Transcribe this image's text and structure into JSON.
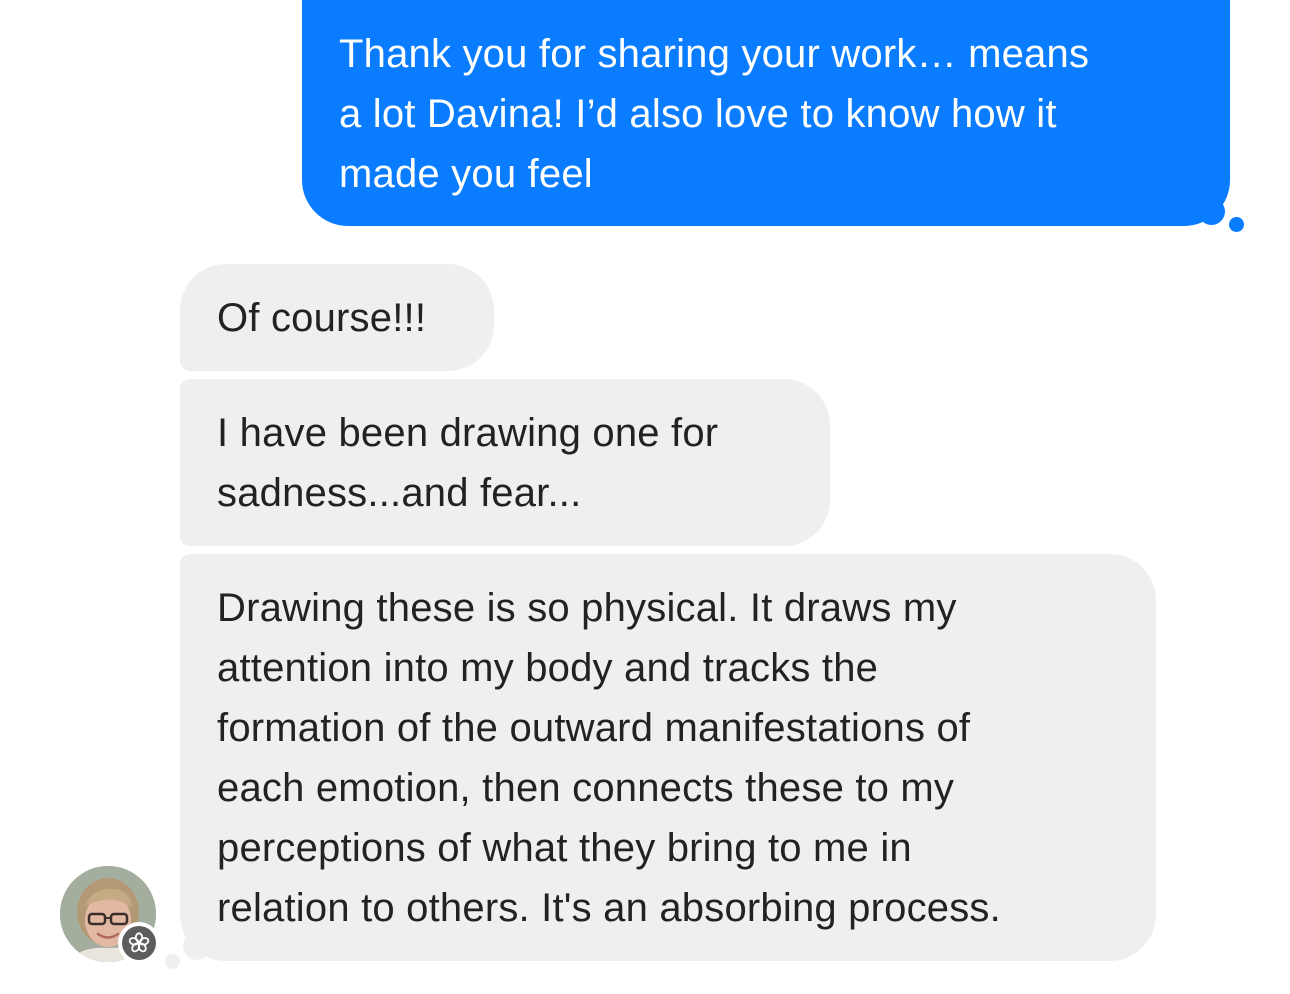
{
  "conversation": {
    "messages": [
      {
        "direction": "sent",
        "text": "Thank you for sharing your work… means\na lot Davina! I’d also love to know how it\nmade you feel"
      },
      {
        "direction": "received",
        "text": "Of course!!!"
      },
      {
        "direction": "received",
        "text": "I have been drawing one for\nsadness...and fear..."
      },
      {
        "direction": "received",
        "text": "Drawing these is so physical. It draws my\nattention into my body and tracks the\nformation of the outward manifestations of\neach emotion, then connects these to my\nperceptions of what they bring to me in\nrelation to others. It's an absorbing process."
      }
    ],
    "contact_avatar": {
      "icon": "contact-avatar",
      "badge_icon": "flower-badge-icon"
    }
  },
  "colors": {
    "sent_bubble": "#0a7cff",
    "received_bubble": "#efefef",
    "received_text": "#222222",
    "background": "#ffffff"
  }
}
